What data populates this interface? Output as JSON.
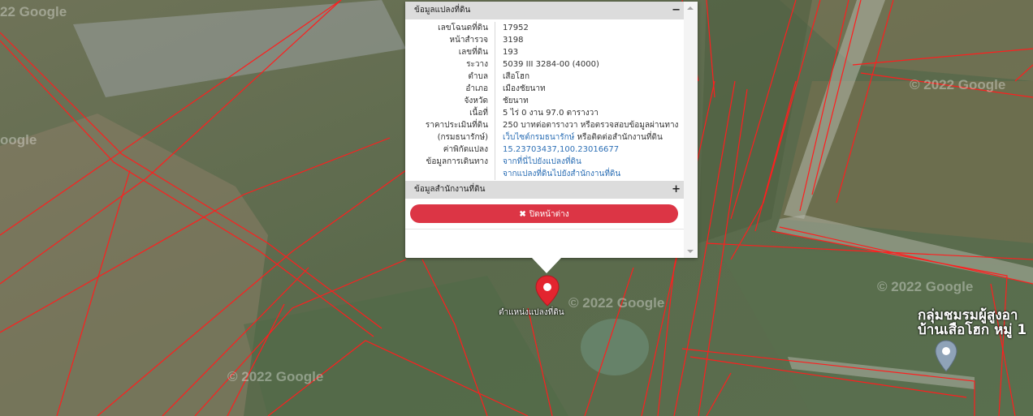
{
  "map": {
    "watermark": "© 2022 Google",
    "watermark_partial_left": "oogle",
    "watermark_partial_top": "22 Google",
    "marker_label": "ตำแหน่งแปลงที่ดิน",
    "poi_label_line1": "กลุ่มชมรมผู้สูงอา",
    "poi_label_line2": "บ้านเสือโฮก หมู่ 1",
    "colors": {
      "parcel_line": "#ff1e1e",
      "marker": "#e3252f",
      "poi_marker": "#8fa3b8"
    }
  },
  "popup": {
    "section1": {
      "title": "ข้อมูลแปลงที่ดิน",
      "toggle": "−"
    },
    "rows": [
      {
        "key": "เลขโฉนดที่ดิน",
        "value": "17952"
      },
      {
        "key": "หน้าสำรวจ",
        "value": "3198"
      },
      {
        "key": "เลขที่ดิน",
        "value": "193"
      },
      {
        "key": "ระวาง",
        "value": "5039 III 3284-00 (4000)"
      },
      {
        "key": "ตำบล",
        "value": "เสือโฮก"
      },
      {
        "key": "อำเภอ",
        "value": "เมืองชัยนาท"
      },
      {
        "key": "จังหวัด",
        "value": "ชัยนาท"
      },
      {
        "key": "เนื้อที่",
        "value": "5 ไร่ 0 งาน 97.0 ตารางวา"
      },
      {
        "key": "ราคาประเมินที่ดิน",
        "value": "250 บาทต่อตารางวา หรือตรวจสอบข้อมูลผ่านทาง"
      },
      {
        "key": "(กรมธนารักษ์)",
        "link": "เว็บไซต์กรมธนารักษ์",
        "value_suffix": " หรือติดต่อสำนักงานที่ดิน"
      },
      {
        "key": "ค่าพิกัดแปลง",
        "link": "15.23703437,100.23016677"
      },
      {
        "key": "ข้อมูลการเดินทาง",
        "link": "จากที่นี่ไปยังแปลงที่ดิน"
      },
      {
        "key": "",
        "link": "จากแปลงที่ดินไปยังสำนักงานที่ดิน"
      }
    ],
    "section2": {
      "title": "ข้อมูลสำนักงานที่ดิน",
      "toggle": "+"
    },
    "close_button": {
      "icon": "✖",
      "label": "ปิดหน้าต่าง",
      "color": "#dc3545"
    }
  }
}
